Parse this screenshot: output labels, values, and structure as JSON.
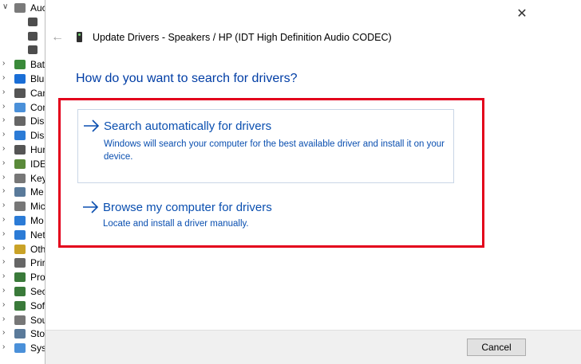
{
  "device_tree": {
    "items": [
      {
        "label": "Auc",
        "expanded": true,
        "icon": "speaker-icon",
        "color": "#7a7a7a"
      },
      {
        "label": "Bat",
        "expanded": false,
        "icon": "battery-icon",
        "color": "#3a8a3a"
      },
      {
        "label": "Blu",
        "expanded": false,
        "icon": "bluetooth-icon",
        "color": "#1a6ed6"
      },
      {
        "label": "Can",
        "expanded": false,
        "icon": "camera-icon",
        "color": "#555555"
      },
      {
        "label": "Con",
        "expanded": false,
        "icon": "computer-icon",
        "color": "#4a90d9"
      },
      {
        "label": "Disl",
        "expanded": false,
        "icon": "disk-drive-icon",
        "color": "#666666"
      },
      {
        "label": "Disp",
        "expanded": false,
        "icon": "display-adapter-icon",
        "color": "#2b7bd6"
      },
      {
        "label": "Hur",
        "expanded": false,
        "icon": "hid-icon",
        "color": "#555555"
      },
      {
        "label": "IDE",
        "expanded": false,
        "icon": "ide-controller-icon",
        "color": "#5a8a3a"
      },
      {
        "label": "Key",
        "expanded": false,
        "icon": "keyboard-icon",
        "color": "#777777"
      },
      {
        "label": "Me",
        "expanded": false,
        "icon": "memory-icon",
        "color": "#5a7a9a"
      },
      {
        "label": "Mic",
        "expanded": false,
        "icon": "mouse-icon",
        "color": "#777777"
      },
      {
        "label": "Mo",
        "expanded": false,
        "icon": "monitor-icon",
        "color": "#2b7bd6"
      },
      {
        "label": "Net",
        "expanded": false,
        "icon": "network-adapter-icon",
        "color": "#2b7bd6"
      },
      {
        "label": "Oth",
        "expanded": false,
        "icon": "other-device-icon",
        "color": "#c9a227"
      },
      {
        "label": "Prir",
        "expanded": false,
        "icon": "print-queue-icon",
        "color": "#666666"
      },
      {
        "label": "Pro",
        "expanded": false,
        "icon": "processor-icon",
        "color": "#3a7a3a"
      },
      {
        "label": "Sec",
        "expanded": false,
        "icon": "security-device-icon",
        "color": "#3a7a3a"
      },
      {
        "label": "Sof",
        "expanded": false,
        "icon": "software-component-icon",
        "color": "#3a7a3a"
      },
      {
        "label": "Sou",
        "expanded": false,
        "icon": "sound-controller-icon",
        "color": "#777777"
      },
      {
        "label": "Sto",
        "expanded": false,
        "icon": "storage-controller-icon",
        "color": "#5a7a9a"
      },
      {
        "label": "Sys",
        "expanded": false,
        "icon": "system-device-icon",
        "color": "#4a90d9"
      }
    ]
  },
  "dialog": {
    "close_glyph": "✕",
    "back_glyph": "←",
    "title": "Update Drivers - Speakers / HP (IDT High Definition Audio CODEC)",
    "question": "How do you want to search for drivers?",
    "options": [
      {
        "title": "Search automatically for drivers",
        "description": "Windows will search your computer for the best available driver and install it on your device."
      },
      {
        "title": "Browse my computer for drivers",
        "description": "Locate and install a driver manually."
      }
    ],
    "cancel_label": "Cancel"
  },
  "colors": {
    "link_blue": "#0a4fb0",
    "heading_blue": "#003da5",
    "highlight_red": "#e3001b"
  }
}
